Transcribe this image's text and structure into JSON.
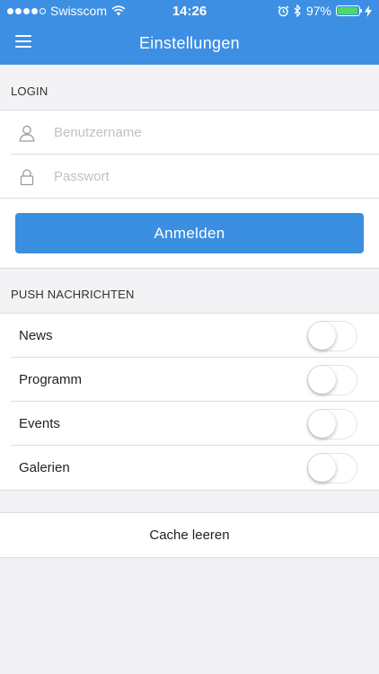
{
  "status_bar": {
    "carrier": "Swisscom",
    "time": "14:26",
    "battery": "97%",
    "battery_level": 0.97,
    "signal_bars": 4,
    "signal_max": 5
  },
  "header": {
    "title": "Einstellungen",
    "menu_icon": "hamburger-menu-icon",
    "color": "#3d8fe3"
  },
  "login": {
    "section_title": "LOGIN",
    "username_placeholder": "Benutzername",
    "password_placeholder": "Passwort",
    "submit_label": "Anmelden",
    "button_color": "#3b8fe0"
  },
  "push": {
    "section_title": "PUSH NACHRICHTEN",
    "items": [
      {
        "label": "News",
        "enabled": false
      },
      {
        "label": "Programm",
        "enabled": false
      },
      {
        "label": "Events",
        "enabled": false
      },
      {
        "label": "Galerien",
        "enabled": false
      }
    ]
  },
  "cache": {
    "label": "Cache leeren"
  }
}
